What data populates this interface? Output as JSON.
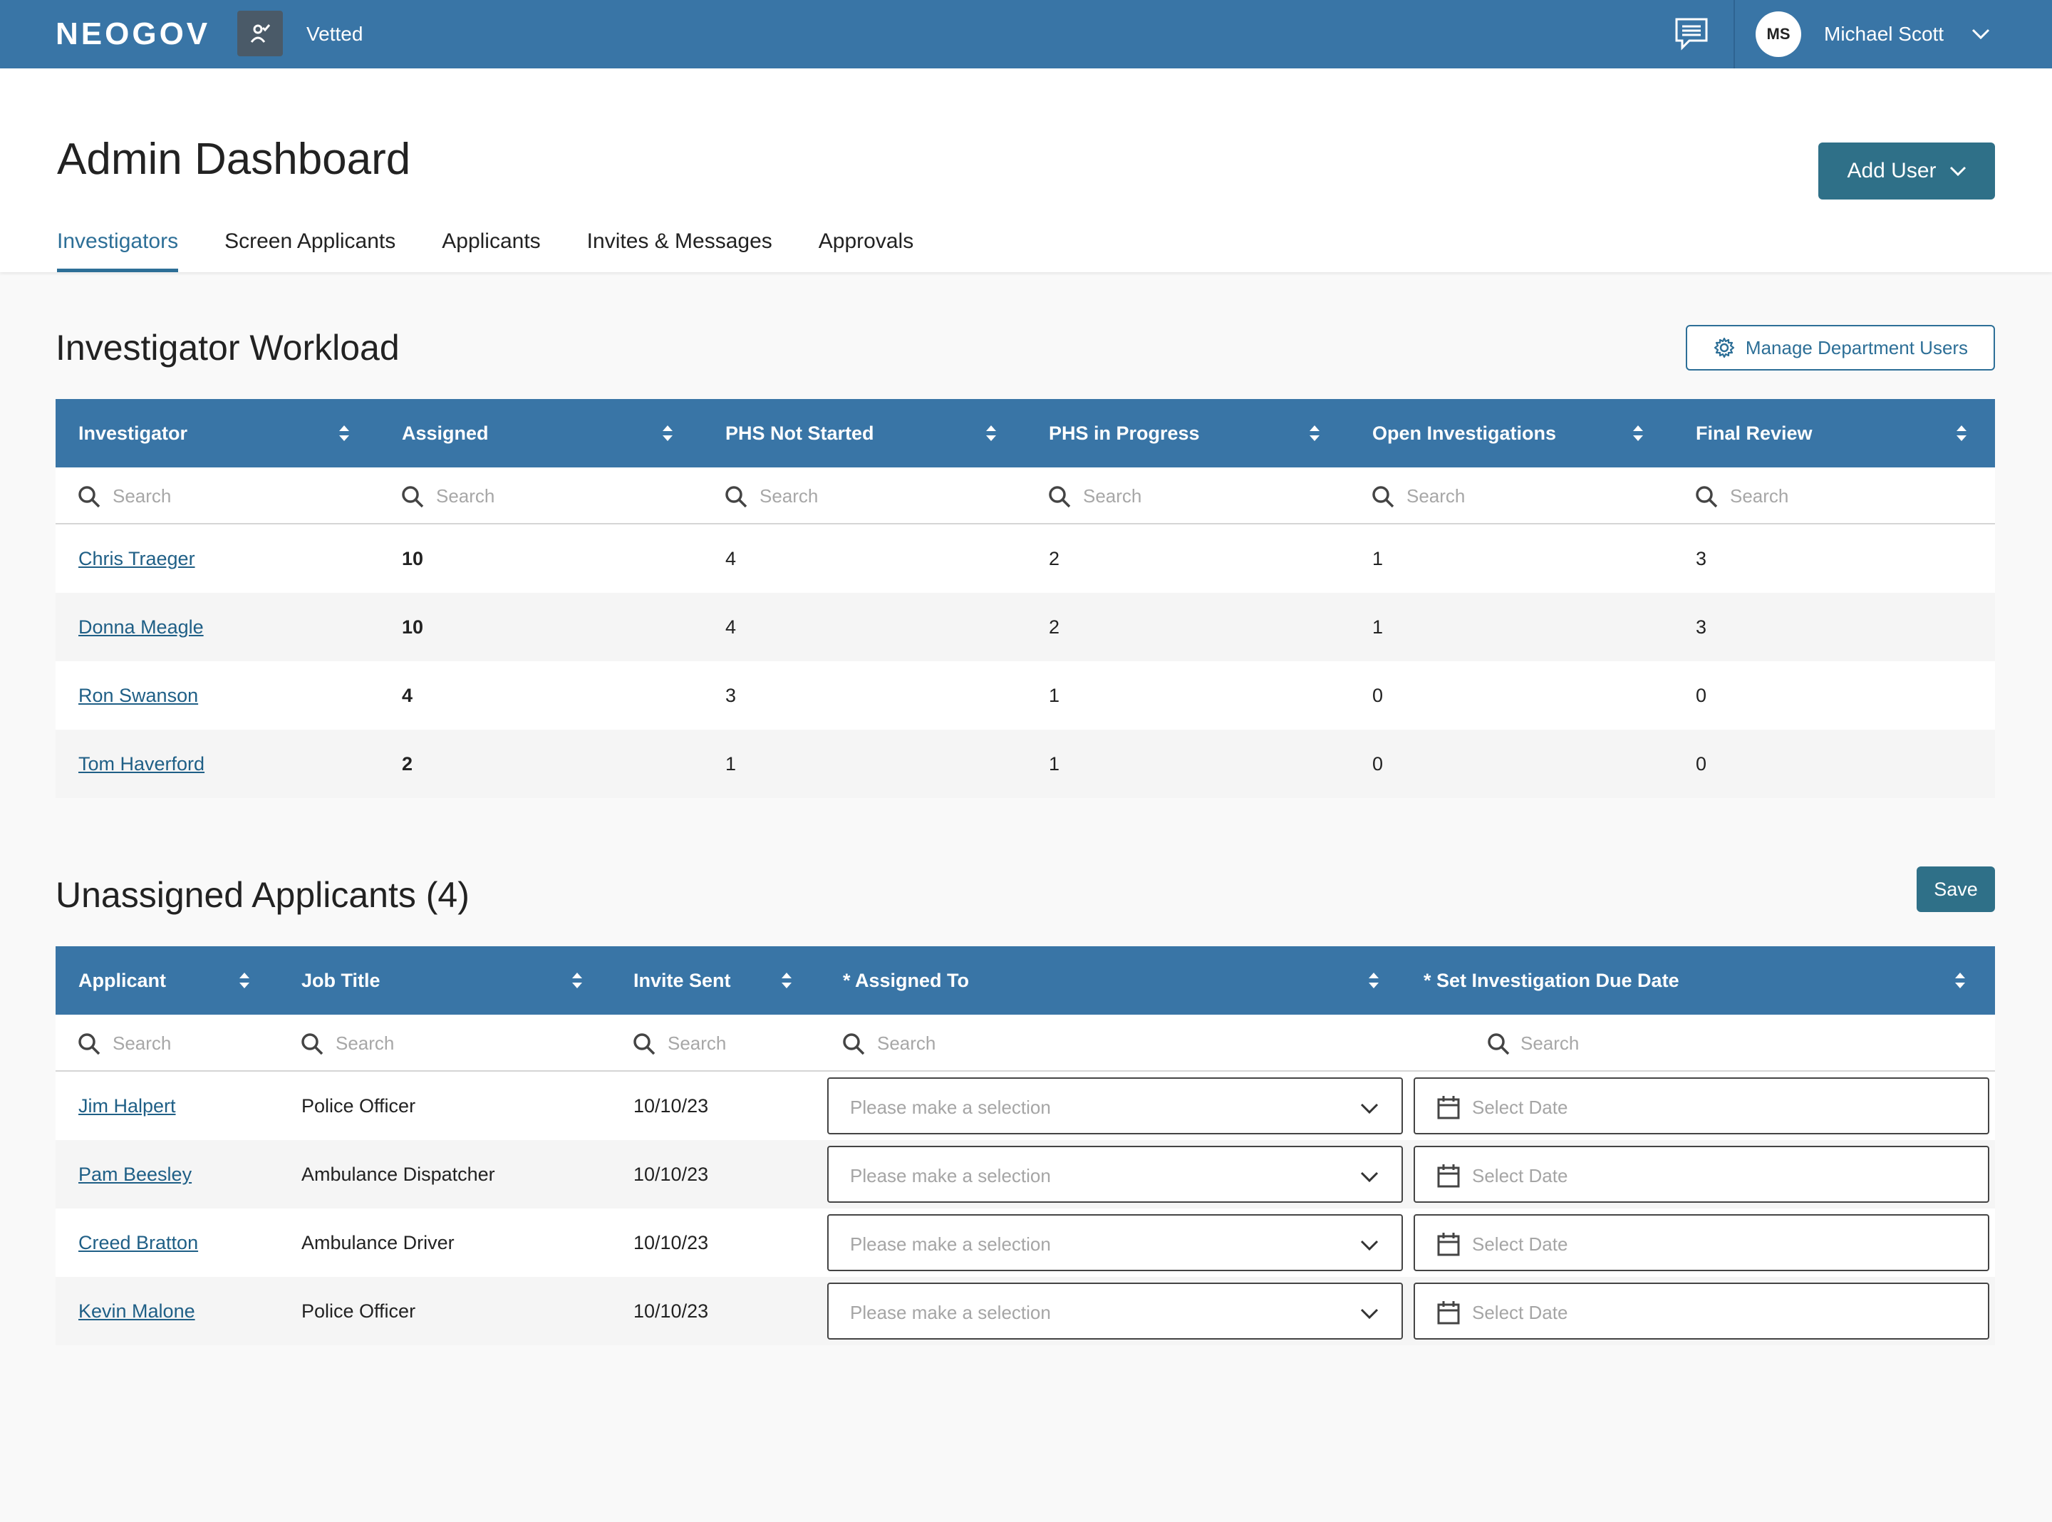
{
  "topbar": {
    "brand": "NEOGOV",
    "product_name": "Vetted",
    "user_initials": "MS",
    "user_name": "Michael Scott"
  },
  "header": {
    "title": "Admin Dashboard",
    "add_user_label": "Add User",
    "tabs": [
      "Investigators",
      "Screen Applicants",
      "Applicants",
      "Invites & Messages",
      "Approvals"
    ],
    "active_tab": "Investigators"
  },
  "workload": {
    "title": "Investigator Workload",
    "manage_label": "Manage Department Users",
    "columns": [
      "Investigator",
      "Assigned",
      "PHS Not Started",
      "PHS in Progress",
      "Open Investigations",
      "Final Review"
    ],
    "search_placeholder": "Search",
    "rows": [
      {
        "name": "Chris Traeger",
        "assigned": "10",
        "phs_not_started": "4",
        "phs_in_progress": "2",
        "open": "1",
        "final": "3"
      },
      {
        "name": "Donna Meagle",
        "assigned": "10",
        "phs_not_started": "4",
        "phs_in_progress": "2",
        "open": "1",
        "final": "3"
      },
      {
        "name": "Ron Swanson",
        "assigned": "4",
        "phs_not_started": "3",
        "phs_in_progress": "1",
        "open": "0",
        "final": "0"
      },
      {
        "name": "Tom Haverford",
        "assigned": "2",
        "phs_not_started": "1",
        "phs_in_progress": "1",
        "open": "0",
        "final": "0"
      }
    ]
  },
  "unassigned": {
    "title": "Unassigned Applicants (4)",
    "save_label": "Save",
    "columns": [
      "Applicant",
      "Job Title",
      "Invite Sent",
      "* Assigned To",
      "* Set Investigation Due Date"
    ],
    "search_placeholder": "Search",
    "select_placeholder": "Please make a selection",
    "date_placeholder": "Select Date",
    "rows": [
      {
        "name": "Jim Halpert",
        "job": "Police Officer",
        "invite": "10/10/23"
      },
      {
        "name": "Pam Beesley",
        "job": "Ambulance Dispatcher",
        "invite": "10/10/23"
      },
      {
        "name": "Creed Bratton",
        "job": "Ambulance Driver",
        "invite": "10/10/23"
      },
      {
        "name": "Kevin Malone",
        "job": "Police Officer",
        "invite": "10/10/23"
      }
    ]
  },
  "colors": {
    "primary_bar": "#3975a6",
    "button": "#2f7088",
    "link": "#1f5f86"
  },
  "icons": {
    "product": "vetted-person-check-icon",
    "chat": "chat-icon",
    "chevron": "chevron-down-icon",
    "gear": "gear-icon",
    "sort": "sort-icon",
    "search": "search-icon",
    "calendar": "calendar-icon"
  }
}
